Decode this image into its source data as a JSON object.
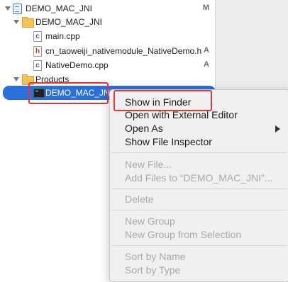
{
  "tree": {
    "project": {
      "name": "DEMO_MAC_JNI",
      "badge": "M"
    },
    "group": {
      "name": "DEMO_MAC_JNI"
    },
    "files": [
      {
        "name": "main.cpp",
        "badge": "",
        "icon": "cpp-file-icon",
        "glyph": "c"
      },
      {
        "name": "cn_taoweiji_nativemodule_NativeDemo.h",
        "badge": "A",
        "icon": "header-file-icon",
        "glyph": "h"
      },
      {
        "name": "NativeDemo.cpp",
        "badge": "A",
        "icon": "cpp-file-icon",
        "glyph": "c"
      }
    ],
    "products": {
      "name": "Products"
    },
    "product_item": {
      "name": "DEMO_MAC_JNI"
    }
  },
  "context_menu": {
    "show_in_finder": "Show in Finder",
    "open_external": "Open with External Editor",
    "open_as": "Open As",
    "show_inspector": "Show File Inspector",
    "new_file": "New File...",
    "add_files": "Add Files to “DEMO_MAC_JNI”...",
    "delete": "Delete",
    "new_group": "New Group",
    "new_group_selection": "New Group from Selection",
    "sort_by_name": "Sort by Name",
    "sort_by_type": "Sort by Type"
  },
  "colors": {
    "selection": "#2a6fdb",
    "highlight_box": "#e0383a",
    "folder": "#f1c453"
  }
}
